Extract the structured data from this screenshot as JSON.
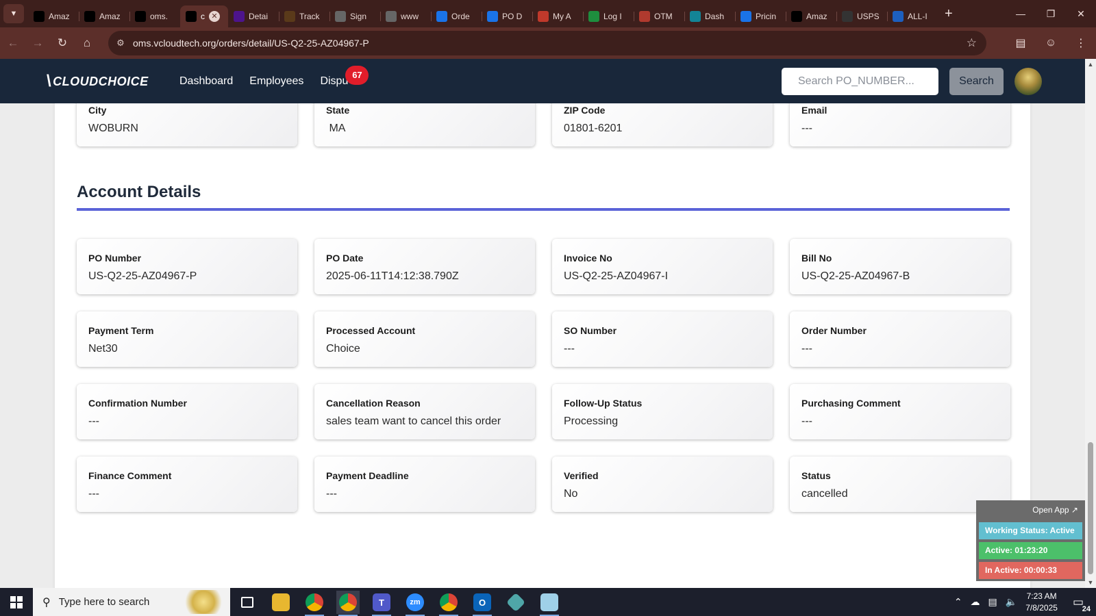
{
  "browser": {
    "tabs": [
      {
        "title": "Amaz",
        "icon": "amazon-icon"
      },
      {
        "title": "Amaz",
        "icon": "amazon-icon"
      },
      {
        "title": "oms.",
        "icon": "cloudchoice-icon"
      },
      {
        "title": "c",
        "icon": "cloudchoice-icon",
        "active": true
      },
      {
        "title": "Detai",
        "icon": "fedex-icon"
      },
      {
        "title": "Track",
        "icon": "ups-icon"
      },
      {
        "title": "Sign",
        "icon": "globe-icon"
      },
      {
        "title": "www",
        "icon": "globe-icon"
      },
      {
        "title": "Orde",
        "icon": "ec-icon"
      },
      {
        "title": "PO D",
        "icon": "ec-icon"
      },
      {
        "title": "My A",
        "icon": "account-icon"
      },
      {
        "title": "Log I",
        "icon": "login-icon"
      },
      {
        "title": "OTM",
        "icon": "otm-icon"
      },
      {
        "title": "Dash",
        "icon": "dashboard-icon"
      },
      {
        "title": "Pricin",
        "icon": "pricing-icon"
      },
      {
        "title": "Amaz",
        "icon": "amazon-icon"
      },
      {
        "title": "USPS",
        "icon": "usps-icon"
      },
      {
        "title": "ALL-I",
        "icon": "seventeen-icon"
      }
    ],
    "url": "oms.vcloudtech.org/orders/detail/US-Q2-25-AZ04967-P"
  },
  "app": {
    "logo_text": "CLOUDCHOICE",
    "nav": {
      "dashboard": "Dashboard",
      "employees": "Employees",
      "disputes": "Dispu",
      "disputes_badge": "67"
    },
    "search": {
      "placeholder": "Search PO_NUMBER...",
      "button": "Search"
    }
  },
  "address_fields": [
    {
      "label": "City",
      "value": "WOBURN"
    },
    {
      "label": "State",
      "value": " MA"
    },
    {
      "label": "ZIP Code",
      "value": "01801-6201"
    },
    {
      "label": "Email",
      "value": "---"
    }
  ],
  "account_details": {
    "title": "Account Details",
    "fields": [
      {
        "label": "PO Number",
        "value": "US-Q2-25-AZ04967-P"
      },
      {
        "label": "PO Date",
        "value": "2025-06-11T14:12:38.790Z"
      },
      {
        "label": "Invoice No",
        "value": "US-Q2-25-AZ04967-I"
      },
      {
        "label": "Bill No",
        "value": "US-Q2-25-AZ04967-B"
      },
      {
        "label": "Payment Term",
        "value": "Net30"
      },
      {
        "label": "Processed Account",
        "value": "Choice"
      },
      {
        "label": "SO Number",
        "value": "---"
      },
      {
        "label": "Order Number",
        "value": "---"
      },
      {
        "label": "Confirmation Number",
        "value": "---"
      },
      {
        "label": "Cancellation Reason",
        "value": "sales team want to cancel this order"
      },
      {
        "label": "Follow-Up Status",
        "value": "Processing"
      },
      {
        "label": "Purchasing Comment",
        "value": "---"
      },
      {
        "label": "Finance Comment",
        "value": "---"
      },
      {
        "label": "Payment Deadline",
        "value": "---"
      },
      {
        "label": "Verified",
        "value": "No"
      },
      {
        "label": "Status",
        "value": "cancelled"
      }
    ]
  },
  "status_widget": {
    "open_app": "Open App ↗",
    "working_status": "Working Status: Active",
    "active": "Active: 01:23:20",
    "inactive": "In Active: 00:00:33"
  },
  "taskbar": {
    "search_placeholder": "Type here to search",
    "time": "7:23 AM",
    "date": "7/8/2025",
    "notifications": "24"
  },
  "colors": {
    "chrome_dark": "#3d1f1c",
    "chrome_toolbar": "#5c2f2a",
    "navbar": "#19273a",
    "section_rule": "#5b63d8",
    "badge": "#e11d2a",
    "status_working": "#62bfd0",
    "status_active": "#4cc06a",
    "status_inactive": "#e1675f"
  }
}
